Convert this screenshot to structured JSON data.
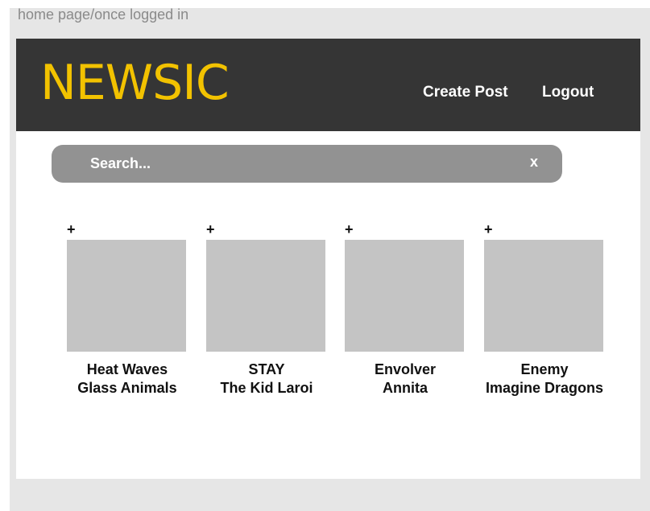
{
  "frame": {
    "label": "home page/once logged in"
  },
  "header": {
    "logo": "NEWSIC",
    "create_post": "Create Post",
    "logout": "Logout"
  },
  "search": {
    "placeholder": "Search...",
    "clear": "x"
  },
  "songs": [
    {
      "add": "+",
      "title": "Heat Waves",
      "artist": "Glass Animals"
    },
    {
      "add": "+",
      "title": "STAY",
      "artist": "The Kid Laroi"
    },
    {
      "add": "+",
      "title": "Envolver",
      "artist": "Annita"
    },
    {
      "add": "+",
      "title": "Enemy",
      "artist": "Imagine Dragons"
    }
  ],
  "colors": {
    "navbar": "#353535",
    "logo": "#f2c200",
    "search_bar": "#929292",
    "placeholder_art": "#c4c4c4"
  }
}
